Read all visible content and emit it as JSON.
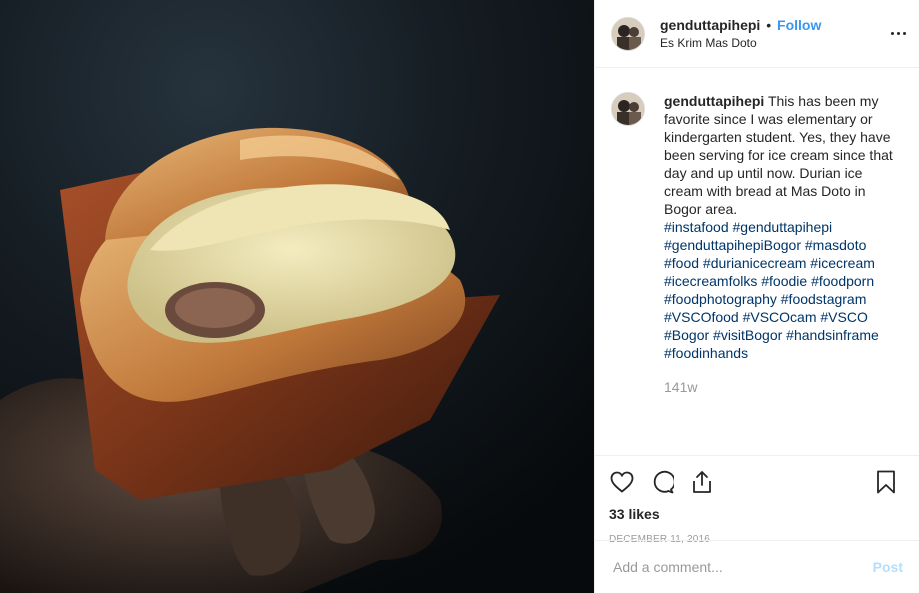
{
  "post": {
    "username": "genduttapihepi",
    "separator": "•",
    "follow_label": "Follow",
    "location": "Es Krim Mas Doto",
    "caption_text": "This has been my favorite since I was elementary or kindergarten student. Yes, they have been serving for ice cream since that day and up until now. Durian ice cream with bread at Mas Doto in Bogor area.",
    "hashtags": "#instafood #genduttapihepi #genduttapihepiBogor #masdoto #food #durianicecream #icecream #icecreamfolks #foodie #foodporn #foodphotography #foodstagram #VSCOfood #VSCOcam #VSCO #Bogor #visitBogor #handsinframe #foodinhands",
    "age": "141w",
    "likes": "33 likes",
    "date": "DECEMBER 11, 2016",
    "comment_placeholder": "Add a comment...",
    "post_label": "Post"
  },
  "icons": {
    "more": "more-options-icon",
    "like": "heart-icon",
    "comment": "comment-icon",
    "share": "share-icon",
    "save": "bookmark-icon"
  },
  "colors": {
    "follow": "#3897f0",
    "hashtag": "#003569",
    "post_button_disabled": "#b2dffc"
  }
}
